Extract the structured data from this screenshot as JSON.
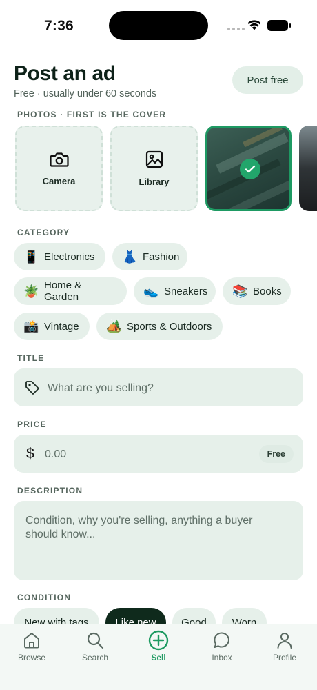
{
  "status": {
    "time": "7:36"
  },
  "header": {
    "title": "Post an ad",
    "subtitle": "Free · usually under 60 seconds",
    "post_button": "Post free"
  },
  "photos": {
    "label": "PHOTOS · FIRST IS THE COVER",
    "camera_label": "Camera",
    "library_label": "Library"
  },
  "category": {
    "label": "CATEGORY",
    "items": [
      {
        "emoji": "📱",
        "label": "Electronics"
      },
      {
        "emoji": "👗",
        "label": "Fashion"
      },
      {
        "emoji": "🪴",
        "label": "Home & Garden"
      },
      {
        "emoji": "👟",
        "label": "Sneakers"
      },
      {
        "emoji": "📚",
        "label": "Books"
      },
      {
        "emoji": "📸",
        "label": "Vintage"
      },
      {
        "emoji": "🏕️",
        "label": "Sports & Outdoors"
      }
    ]
  },
  "title_field": {
    "label": "TITLE",
    "placeholder": "What are you selling?"
  },
  "price_field": {
    "label": "PRICE",
    "currency": "$",
    "placeholder": "0.00",
    "free_badge": "Free"
  },
  "description_field": {
    "label": "DESCRIPTION",
    "placeholder": "Condition, why you're selling, anything a buyer should know..."
  },
  "condition": {
    "label": "CONDITION",
    "options": [
      "New with tags",
      "Like new",
      "Good",
      "Worn"
    ],
    "selected": "Like new"
  },
  "tabbar": {
    "items": [
      {
        "label": "Browse",
        "icon": "home-icon"
      },
      {
        "label": "Search",
        "icon": "search-icon"
      },
      {
        "label": "Sell",
        "icon": "plus-circle-icon"
      },
      {
        "label": "Inbox",
        "icon": "chat-bubble-icon"
      },
      {
        "label": "Profile",
        "icon": "person-icon"
      }
    ],
    "active": "Sell"
  },
  "colors": {
    "accent": "#1e9a63",
    "chip_bg": "#e6f0ea",
    "dark": "#0f2a1c"
  }
}
